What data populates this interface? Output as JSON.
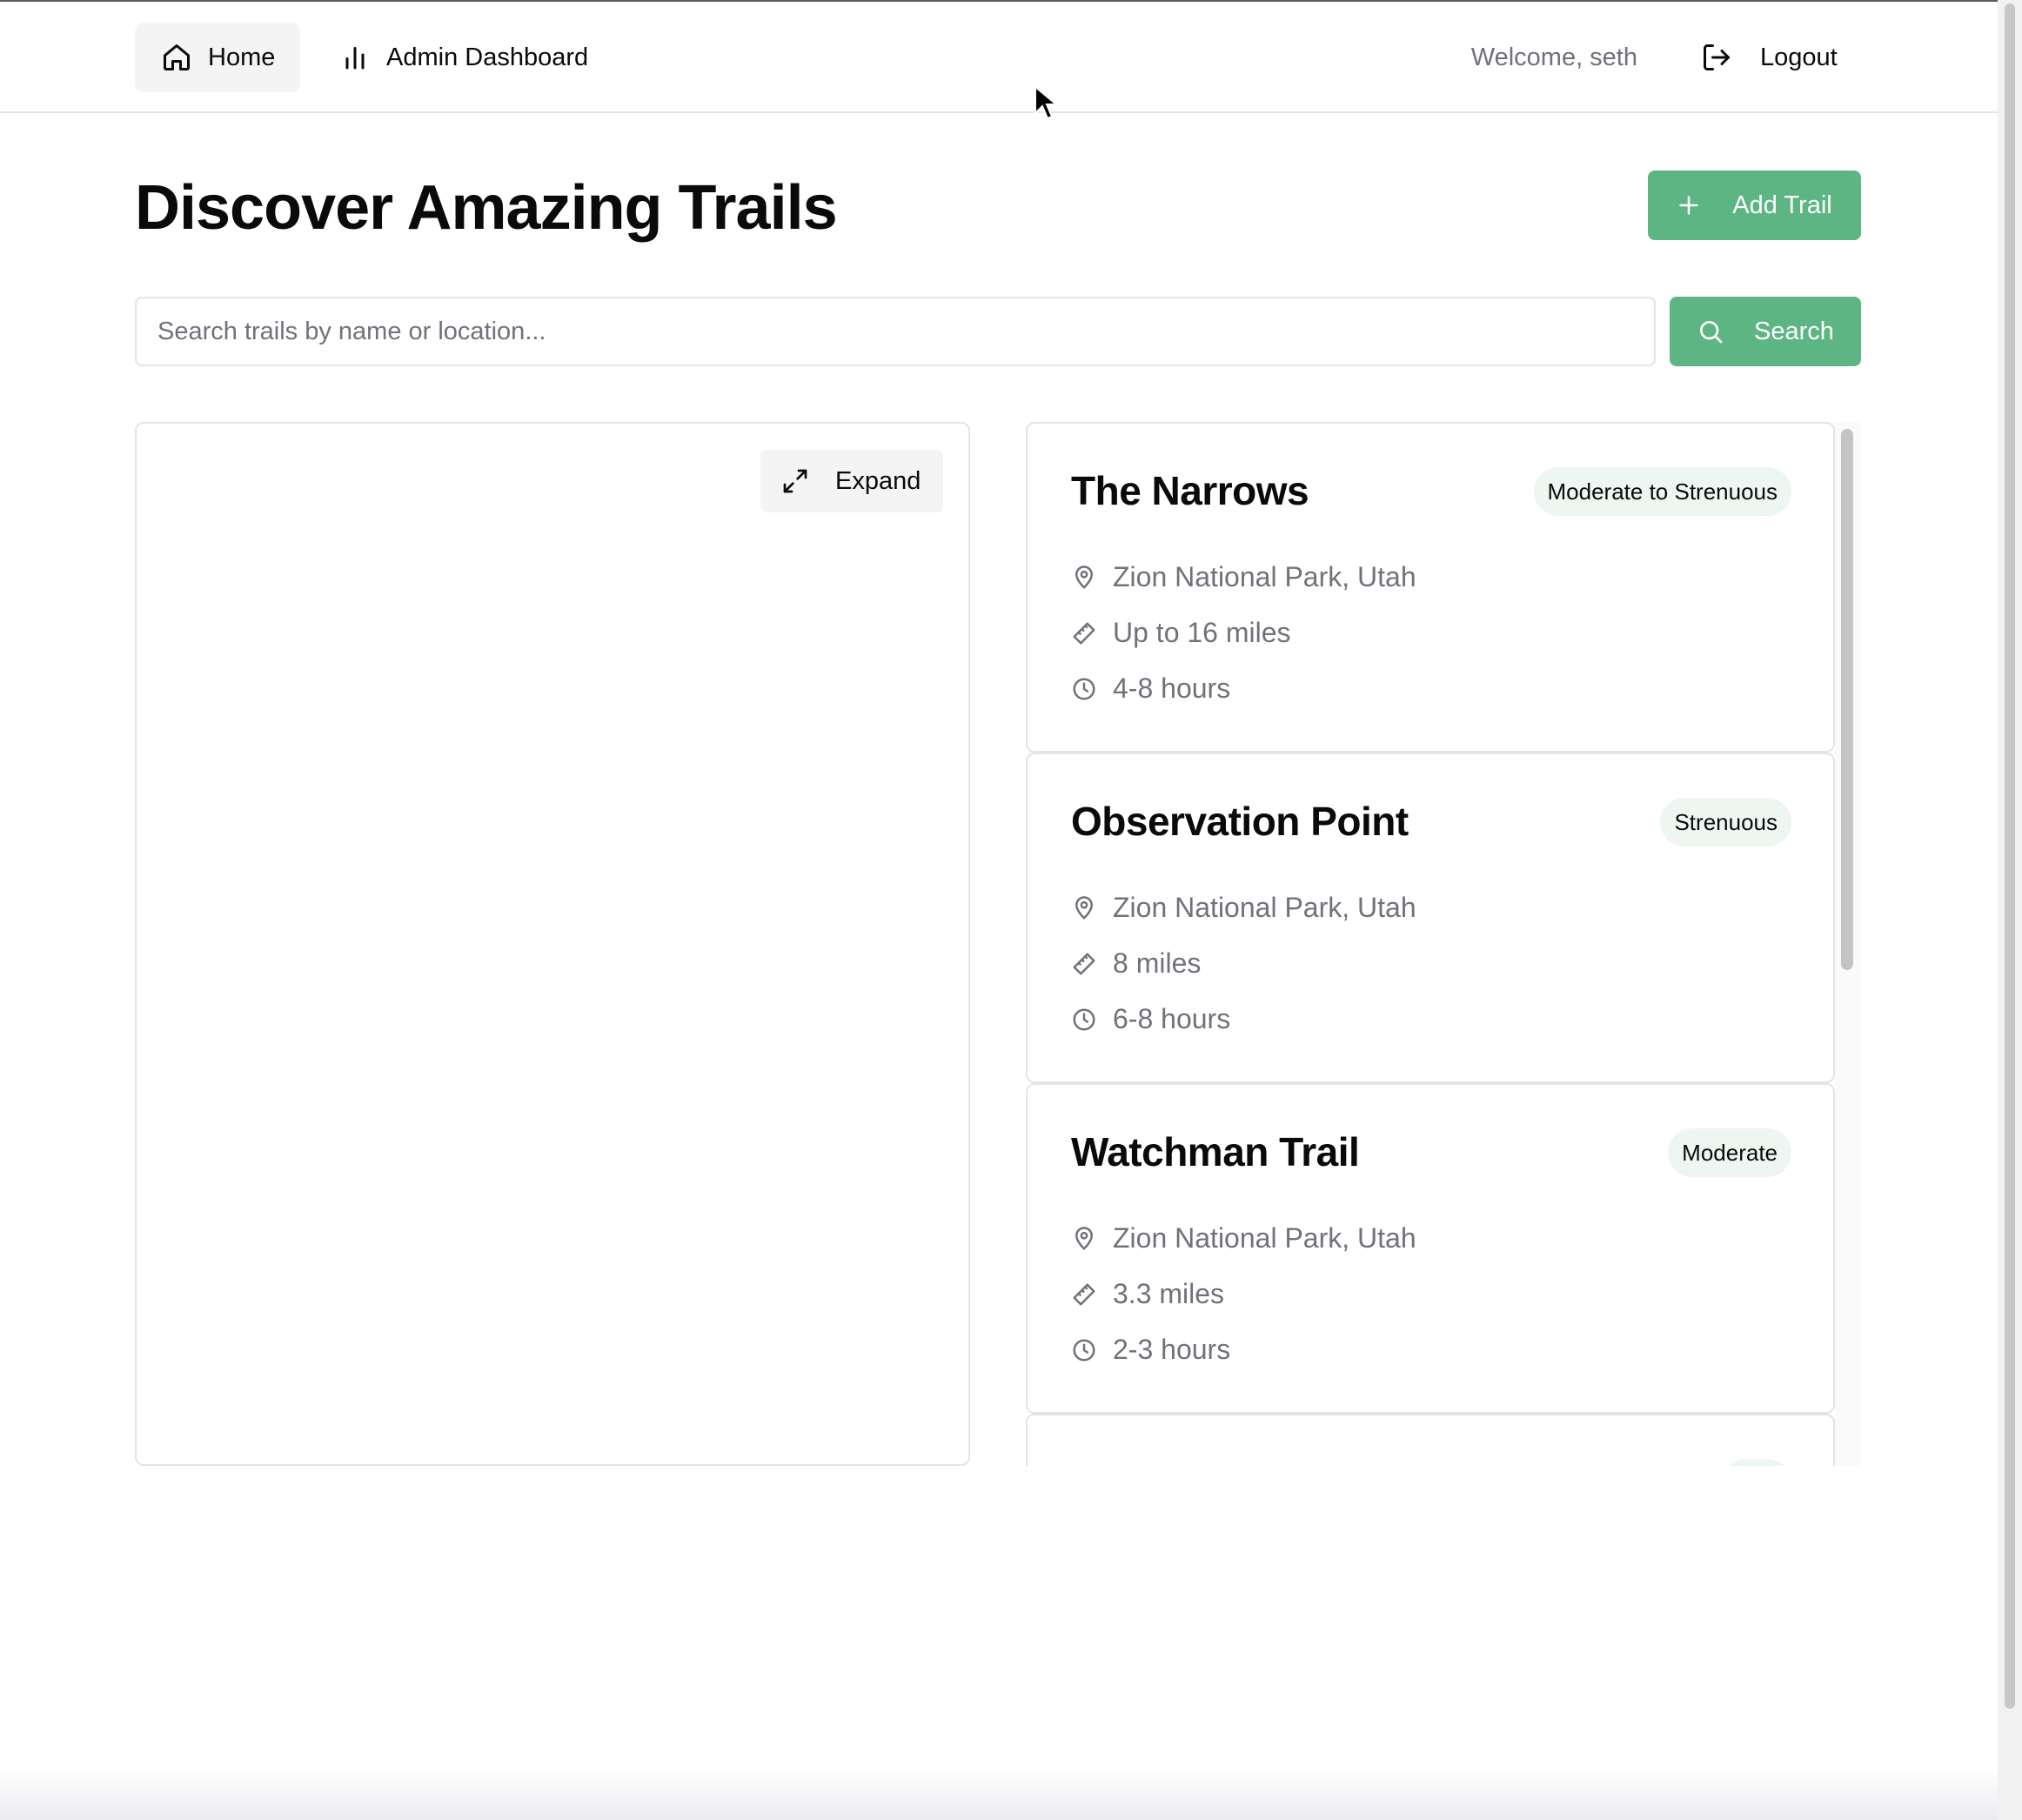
{
  "nav": {
    "home_label": "Home",
    "home_icon": "home-icon",
    "admin_label": "Admin Dashboard",
    "admin_icon": "bar-chart-icon",
    "welcome_text": "Welcome, seth",
    "logout_label": "Logout",
    "logout_icon": "logout-icon"
  },
  "header": {
    "title": "Discover Amazing Trails",
    "add_trail_label": "Add Trail",
    "add_trail_icon": "plus-icon"
  },
  "search": {
    "placeholder": "Search trails by name or location...",
    "value": "",
    "button_label": "Search",
    "button_icon": "search-icon"
  },
  "map": {
    "expand_label": "Expand",
    "expand_icon": "expand-icon"
  },
  "trails": [
    {
      "name": "The Narrows",
      "difficulty": "Moderate to Strenuous",
      "location": "Zion National Park, Utah",
      "distance": "Up to 16 miles",
      "duration": "4-8 hours"
    },
    {
      "name": "Observation Point",
      "difficulty": "Strenuous",
      "location": "Zion National Park, Utah",
      "distance": "8 miles",
      "duration": "6-8 hours"
    },
    {
      "name": "Watchman Trail",
      "difficulty": "Moderate",
      "location": "Zion National Park, Utah",
      "distance": "3.3 miles",
      "duration": "2-3 hours"
    }
  ],
  "colors": {
    "accent": "#5db584",
    "badge_bg": "#eef6f1",
    "muted_text": "#71717a",
    "border": "#e4e4e7"
  }
}
